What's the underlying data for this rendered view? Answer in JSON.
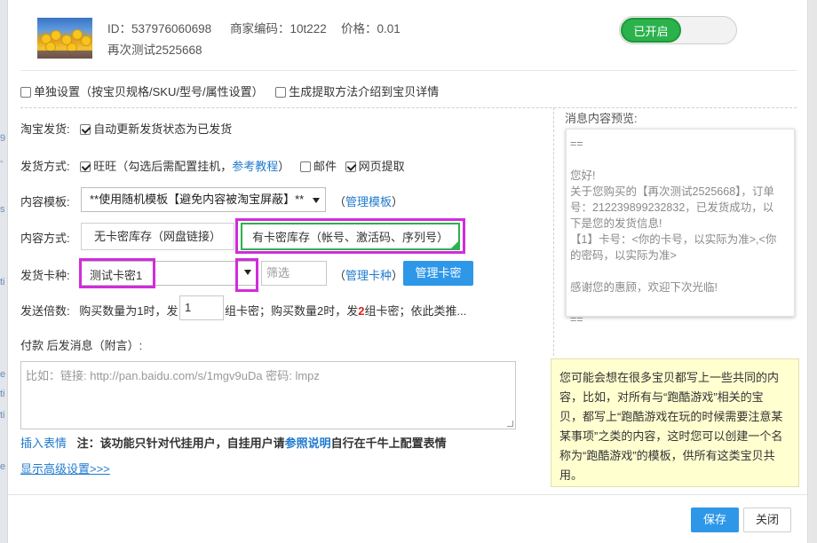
{
  "background": {
    "side_chars": [
      "9",
      "-",
      "s",
      "ti",
      "e",
      "ti",
      "ti",
      "e"
    ]
  },
  "product": {
    "id_text": "ID：537976060698",
    "code_text": "商家编码：10t222",
    "price_text": "价格：0.01",
    "name": "再次测试2525668",
    "enabled_label": "已开启"
  },
  "options": {
    "separate_settings": "单独设置（按宝贝规格/SKU/型号/属性设置）",
    "generate_intro": "生成提取方法介绍到宝贝详情"
  },
  "form": {
    "taobao_ship_label": "淘宝发货:",
    "taobao_ship_option": "自动更新发货状态为已发货",
    "ship_method_label": "发货方式:",
    "wangwang": "旺旺",
    "wangwang_hint": "（勾选后需配置挂机，",
    "tutorial_link": "参考教程",
    "tutorial_close": "）",
    "email": "邮件",
    "webpage": "网页提取",
    "template_label": "内容模板:",
    "template_value": "**使用随机模板【避免内容被淘宝屏蔽】**",
    "manage_template_open": "（",
    "manage_template": "管理模板",
    "manage_template_close": "）",
    "content_method_label": "内容方式:",
    "no_card_stock": "无卡密库存（网盘链接）",
    "card_stock": "有卡密库存（帐号、激活码、序列号）",
    "card_type_label": "发货卡种:",
    "card_type_value": "测试卡密1",
    "filter_placeholder": "筛选",
    "manage_card_type_open": "（",
    "manage_card_type": "管理卡种",
    "manage_card_type_close": "）",
    "manage_cards_button": "管理卡密",
    "multiplier_label": "发送倍数:",
    "multiplier_prefix": "购买数量为1时，发",
    "multiplier_value": "1",
    "multiplier_suffix_a": "组卡密；购买数量2时，发",
    "multiplier_two": "2",
    "multiplier_suffix_b": "组卡密；依此类推...",
    "message_label": "付款 后发消息（附言）:",
    "message_placeholder": "比如：链接: http://pan.baidu.com/s/1mgv9uDa 密码: lmpz",
    "insert_emoji": "插入表情",
    "notice_prefix": "注：该功能只针对代挂用户，自挂用户请",
    "notice_link": "参照说明",
    "notice_suffix": "自行在千牛上配置表情",
    "advanced": "显示高级设置>>>"
  },
  "preview": {
    "title": "消息内容预览:",
    "lines": [
      "==",
      "",
      "您好!",
      "关于您购买的【再次测试2525668】，订单",
      "号：212239899232832，已发货成功，以",
      "下是您的发货信息!",
      "【1】卡号：<你的卡号，以实际为准>,<你",
      "的密码，以实际为准>",
      "",
      "感谢您的惠顾，欢迎下次光临!",
      "",
      "=="
    ]
  },
  "tip": {
    "lines": [
      "您可能会想在很多宝贝都写上一些共同的内",
      "容，比如，对所有与“跑酷游戏”相关的宝",
      "贝，都写上“跑酷游戏在玩的时候需要注意某",
      "某事项”之类的内容，这时您可以创建一个名",
      "称为“跑酷游戏”的模板，供所有这类宝贝共",
      "用。"
    ]
  },
  "footer": {
    "save": "保存",
    "close": "关闭"
  },
  "colors": {
    "accent_blue": "#2e97e8",
    "toggle_green": "#2bb24c",
    "highlight_magenta": "#d22bdc",
    "tip_bg": "#ffffd0"
  }
}
